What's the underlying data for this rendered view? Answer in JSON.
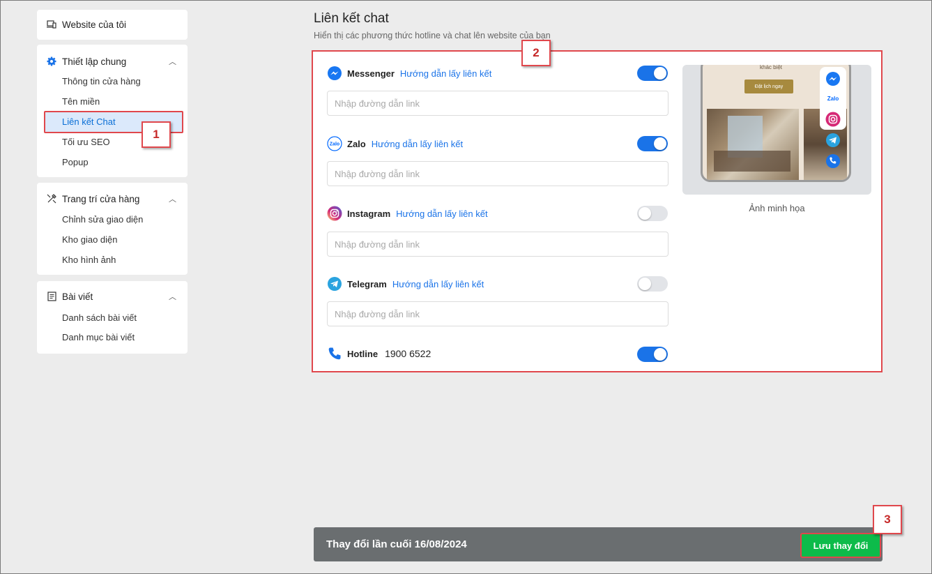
{
  "sidebar": {
    "website": {
      "label": "Website của tôi",
      "icon": "devices-icon"
    },
    "general": {
      "title": "Thiết lập chung",
      "icon": "gear-icon",
      "items": [
        "Thông tin cửa hàng",
        "Tên miền",
        "Liên kết Chat",
        "Tối ưu SEO",
        "Popup"
      ],
      "active": "Liên kết Chat"
    },
    "decor": {
      "title": "Trang trí cửa hàng",
      "icon": "paint-tools-icon",
      "items": [
        "Chỉnh sửa giao diện",
        "Kho giao diện",
        "Kho hình ảnh"
      ]
    },
    "posts": {
      "title": "Bài viết",
      "icon": "article-icon",
      "items": [
        "Danh sách bài viết",
        "Danh mục bài viết"
      ]
    }
  },
  "main": {
    "title": "Liên kết chat",
    "subtitle": "Hiển thị các phương thức hotline và chat lên website của bạn",
    "channels": [
      {
        "name": "Messenger",
        "guide": "Hướng dẫn lấy liên kết",
        "enabled": true,
        "placeholder": "Nhập đường dẫn link",
        "color": "#1877f2"
      },
      {
        "name": "Zalo",
        "guide": "Hướng dẫn lấy liên kết",
        "enabled": true,
        "placeholder": "Nhập đường dẫn link",
        "color": "#0068ff"
      },
      {
        "name": "Instagram",
        "guide": "Hướng dẫn lấy liên kết",
        "enabled": false,
        "placeholder": "Nhập đường dẫn link",
        "color": "#e1306c"
      },
      {
        "name": "Telegram",
        "guide": "Hướng dẫn lấy liên kết",
        "enabled": false,
        "placeholder": "Nhập đường dẫn link",
        "color": "#2aa3df"
      }
    ],
    "hotline": {
      "name": "Hotline",
      "number": "1900 6522",
      "enabled": true
    },
    "preview": {
      "caption": "Ảnh minh họa",
      "headline": "khác biệt",
      "cta": "Đặt lịch ngay",
      "zalo_text": "Zalo"
    }
  },
  "footer": {
    "last_changed": "Thay đổi lần cuối 16/08/2024",
    "save_label": "Lưu thay đổi"
  },
  "annotations": [
    "1",
    "2",
    "3"
  ],
  "colors": {
    "accent": "#1a73e8",
    "save": "#0dbb4a",
    "highlight": "#e0474c",
    "footer": "#6a6e70"
  }
}
